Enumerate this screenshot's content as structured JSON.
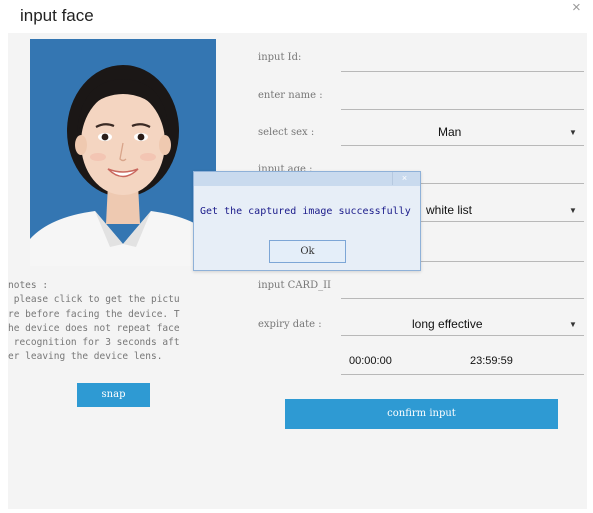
{
  "window": {
    "title": "input face",
    "close_glyph": "×"
  },
  "photo": {
    "alt": "captured face photo",
    "background": "#2f71ae"
  },
  "notes": {
    "text": "notes :\n please click to get the pictu\nre before facing the device. T\nhe device does not repeat face\n recognition for 3 seconds aft\ner leaving the device lens."
  },
  "snap_button": {
    "label": "snap"
  },
  "form": {
    "input_id": {
      "label": "input Id:",
      "value": ""
    },
    "enter_name": {
      "label": "enter name :",
      "value": ""
    },
    "select_sex": {
      "label": "select sex :",
      "value": "Man"
    },
    "input_age": {
      "label": "input age :",
      "value": ""
    },
    "list_type": {
      "value": "white list"
    },
    "blank_field": {
      "value": ""
    },
    "input_card": {
      "label": "input CARD_II",
      "value": ""
    },
    "expiry_date": {
      "label": "expiry date :",
      "value": "long effective"
    },
    "time_start": "00:00:00",
    "time_end": "23:59:59"
  },
  "confirm_button": {
    "label": "confirm input"
  },
  "dialog": {
    "close_glyph": "×",
    "message": "Get the captured image successfully",
    "ok_label": "Ok"
  },
  "colors": {
    "accent": "#2e9ad3",
    "panel": "#f4f4f4",
    "dialog_border": "#8fb1d8",
    "dialog_text": "#1a1a8a"
  },
  "icons": {
    "close": "close-icon",
    "dropdown": "chevron-down-icon"
  }
}
